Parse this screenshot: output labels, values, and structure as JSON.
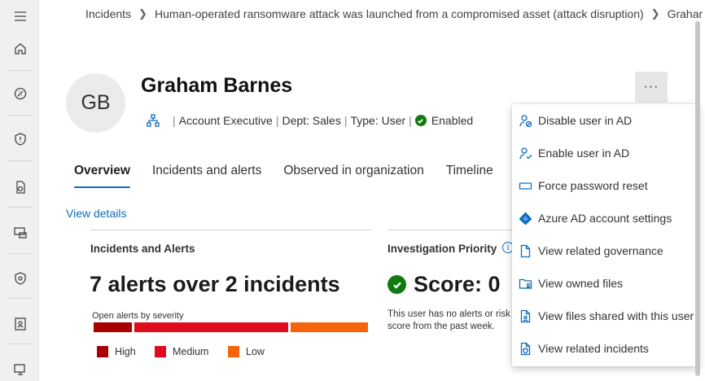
{
  "breadcrumb": {
    "items": [
      "Incidents",
      "Human-operated ransomware attack was launched from a compromised asset (attack disruption)",
      "Grahar"
    ]
  },
  "user": {
    "initials": "GB",
    "name": "Graham Barnes",
    "title": "Account Executive",
    "dept": "Dept: Sales",
    "type": "Type: User",
    "status": "Enabled"
  },
  "more_button": "···",
  "tabs": [
    "Overview",
    "Incidents and alerts",
    "Observed in organization",
    "Timeline"
  ],
  "view_details": "View details",
  "incidents_card": {
    "title": "Incidents and Alerts",
    "summary": "7 alerts over 2 incidents",
    "severity_label": "Open alerts by severity",
    "legend": [
      "High",
      "Medium",
      "Low"
    ],
    "colors": {
      "high": "#a80000",
      "medium": "#e00b1c",
      "low": "#f7630c"
    }
  },
  "priority_card": {
    "title": "Investigation Priority",
    "info_icon": "i",
    "score": "Score: 0",
    "note": "This user has no alerts or risk score from the past week."
  },
  "menu": {
    "items": [
      {
        "label": "Disable user in AD",
        "icon": "person-block-icon"
      },
      {
        "label": "Enable user in AD",
        "icon": "person-check-icon"
      },
      {
        "label": "Force password reset",
        "icon": "password-icon"
      },
      {
        "label": "Azure AD account settings",
        "icon": "azure-ad-icon"
      },
      {
        "label": "View related governance",
        "icon": "document-icon"
      },
      {
        "label": "View owned files",
        "icon": "folder-person-icon"
      },
      {
        "label": "View files shared with this user",
        "icon": "document-person-icon"
      },
      {
        "label": "View related incidents",
        "icon": "document-shield-icon"
      }
    ]
  }
}
